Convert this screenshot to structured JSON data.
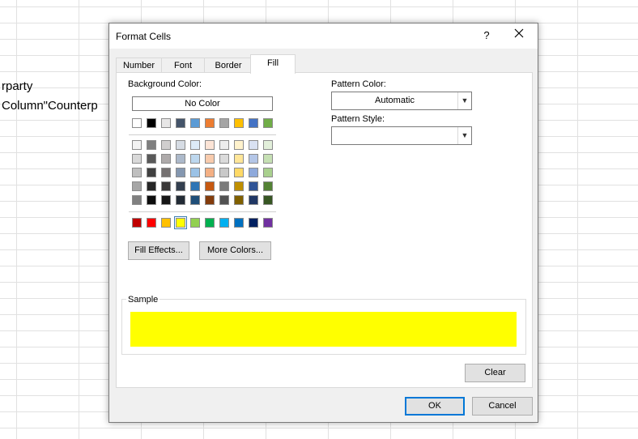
{
  "spreadsheet": {
    "cell_texts": [
      "rparty",
      "Column\"Counterp"
    ]
  },
  "dialog": {
    "title": "Format Cells",
    "help": "?",
    "close": "✕",
    "tabs": [
      "Number",
      "Font",
      "Border",
      "Fill"
    ],
    "active_tab": "Fill",
    "background_color_label": "Background Color:",
    "no_color_label": "No Color",
    "fill_effects_label": "Fill Effects...",
    "more_colors_label": "More Colors...",
    "pattern_color_label": "Pattern Color:",
    "pattern_color_value": "Automatic",
    "pattern_style_label": "Pattern Style:",
    "pattern_style_value": "",
    "sample_label": "Sample",
    "clear_label": "Clear",
    "ok_label": "OK",
    "cancel_label": "Cancel",
    "selected_color": "#FFFF00"
  },
  "palette": {
    "top_row": [
      "#FFFFFF",
      "#000000",
      "#E7E6E6",
      "#44546A",
      "#5B9BD5",
      "#ED7D31",
      "#A5A5A5",
      "#FFC000",
      "#4472C4",
      "#70AD47"
    ],
    "tint_rows": [
      [
        "#F2F2F2",
        "#7F7F7F",
        "#D0CECE",
        "#D6DCE4",
        "#DDEBF7",
        "#FCE4D6",
        "#EDEDED",
        "#FFF2CC",
        "#D9E1F2",
        "#E2EFDA"
      ],
      [
        "#D9D9D9",
        "#595959",
        "#AEAAAA",
        "#ACB9CA",
        "#BDD7EE",
        "#F8CBAD",
        "#DBDBDB",
        "#FFE699",
        "#B4C6E7",
        "#C6E0B4"
      ],
      [
        "#BFBFBF",
        "#404040",
        "#757171",
        "#8497B0",
        "#9BC2E6",
        "#F4B084",
        "#C9C9C9",
        "#FFD966",
        "#8EA9DB",
        "#A9D08E"
      ],
      [
        "#A6A6A6",
        "#262626",
        "#3A3838",
        "#333F4F",
        "#2F75B5",
        "#C65911",
        "#7B7B7B",
        "#BF8F00",
        "#305496",
        "#548235"
      ],
      [
        "#808080",
        "#0D0D0D",
        "#161616",
        "#222B35",
        "#1F4E78",
        "#833C0C",
        "#525252",
        "#806000",
        "#203764",
        "#375623"
      ]
    ],
    "standard_row": [
      "#C00000",
      "#FF0000",
      "#FFC000",
      "#FFFF00",
      "#92D050",
      "#00B050",
      "#00B0F0",
      "#0070C0",
      "#002060",
      "#7030A0"
    ],
    "selected_standard_index": 3
  }
}
